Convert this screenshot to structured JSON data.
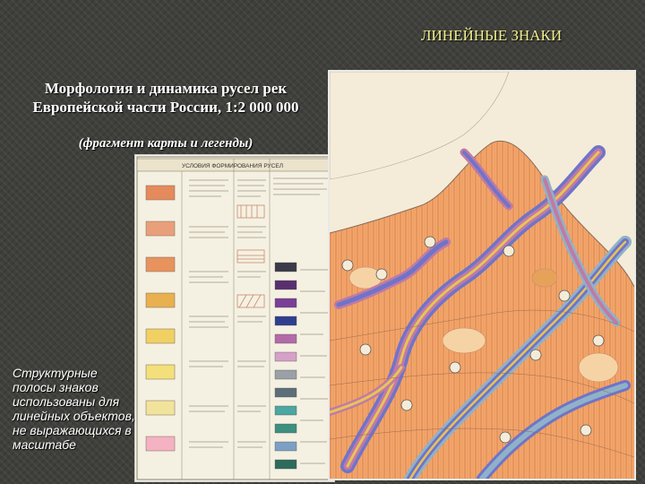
{
  "slide": {
    "title": "ЛИНЕЙНЫЕ ЗНАКИ",
    "subtitle_line1": "Морфология и динамика русел рек",
    "subtitle_line2": "Европейской части России, 1:2 000 000",
    "subtitle_note": "(фрагмент карты и легенды)",
    "caption": "Структурные полосы знаков использованы для линейных объектов, не выражающихся в масштабе"
  },
  "legend": {
    "header": "УСЛОВИЯ ФОРМИРОВАНИЯ РУСЕЛ",
    "swatch_colors": [
      "#e58a5c",
      "#e9a07a",
      "#e8935e",
      "#e8b04e",
      "#f1d063",
      "#f3e07a",
      "#f2e39c",
      "#f4b2c3"
    ],
    "line_colors": [
      "#3a3a48",
      "#5a2f6e",
      "#7a3f96",
      "#2f3f8e",
      "#b36aa8",
      "#d6a1c8",
      "#9aa0a6",
      "#5e6e78",
      "#4aa7a1",
      "#3d8f7f",
      "#7d9fc4",
      "#2f6b5c"
    ]
  },
  "map": {
    "base_color": "#f3a86a",
    "hatch_color": "#d2754a",
    "sea_color": "#f4ecd8",
    "river_band_colors": [
      "#6f74c9",
      "#c07aa6",
      "#e8c455",
      "#8fb2c8"
    ]
  }
}
